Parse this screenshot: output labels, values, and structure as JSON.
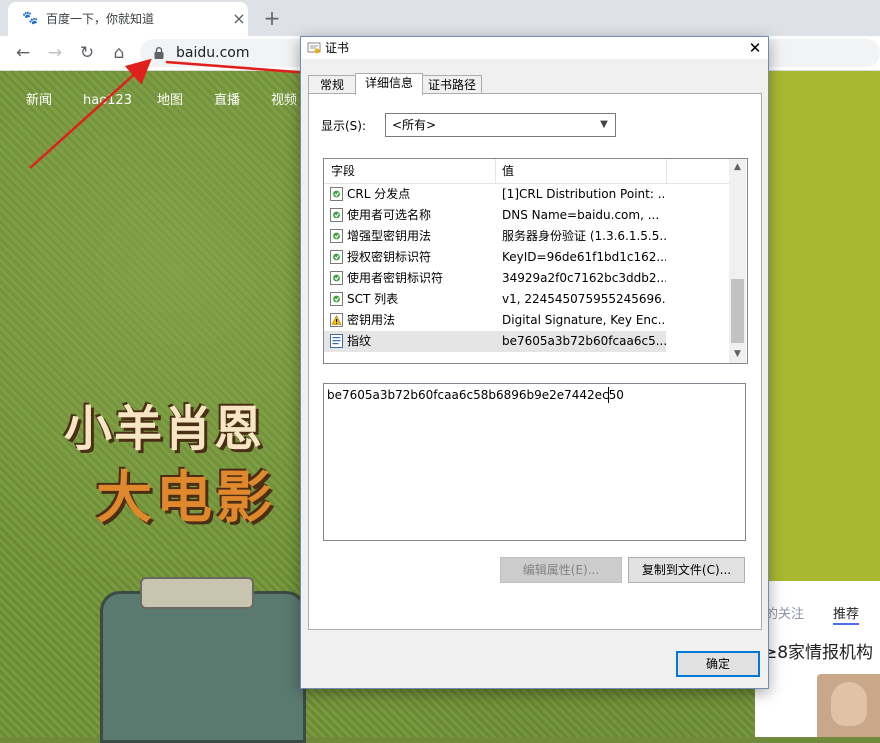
{
  "browser": {
    "tab_title": "百度一下，你就知道",
    "tab_favicon": "baidu-paw-icon",
    "url": "baidu.com",
    "new_tab_glyph": "+"
  },
  "page": {
    "nav_items": [
      "新闻",
      "hao123",
      "地图",
      "直播",
      "视频"
    ],
    "poster_line1": "小羊肖恩",
    "poster_line2": "大电影",
    "feed_tab_follow": "的关注",
    "feed_tab_recommend": "推荐",
    "feed_headline": "≥8家情报机构"
  },
  "dialog": {
    "title": "证书",
    "tabs": [
      "常规",
      "详细信息",
      "证书路径"
    ],
    "active_tab": 1,
    "show_label": "显示(S):",
    "show_value": "<所有>",
    "columns": [
      "字段",
      "值"
    ],
    "rows": [
      {
        "field": "CRL 分发点",
        "value": "[1]CRL Distribution Point: ...",
        "icon": "extension-icon"
      },
      {
        "field": "使用者可选名称",
        "value": "DNS Name=baidu.com, ...",
        "icon": "extension-icon"
      },
      {
        "field": "增强型密钥用法",
        "value": "服务器身份验证 (1.3.6.1.5.5...",
        "icon": "extension-icon"
      },
      {
        "field": "授权密钥标识符",
        "value": "KeyID=96de61f1bd1c162...",
        "icon": "extension-icon"
      },
      {
        "field": "使用者密钥标识符",
        "value": "34929a2f0c7162bc3ddb2...",
        "icon": "extension-icon"
      },
      {
        "field": "SCT 列表",
        "value": "v1, 224545075955245696...",
        "icon": "extension-icon"
      },
      {
        "field": "密钥用法",
        "value": "Digital Signature, Key Enc...",
        "icon": "critical-extension-icon"
      },
      {
        "field": "指纹",
        "value": "be7605a3b72b60fcaa6c5...",
        "icon": "property-icon"
      }
    ],
    "selected_row": 7,
    "detail_text": "be7605a3b72b60fcaa6c58b6896b9e2e7442ec50",
    "edit_properties_label": "编辑属性(E)...",
    "copy_to_file_label": "复制到文件(C)...",
    "ok_label": "确定"
  },
  "colors": {
    "annotation_arrow": "#e0201c",
    "accent_blue": "#4e6ef2",
    "focus_blue": "#0078d7"
  }
}
